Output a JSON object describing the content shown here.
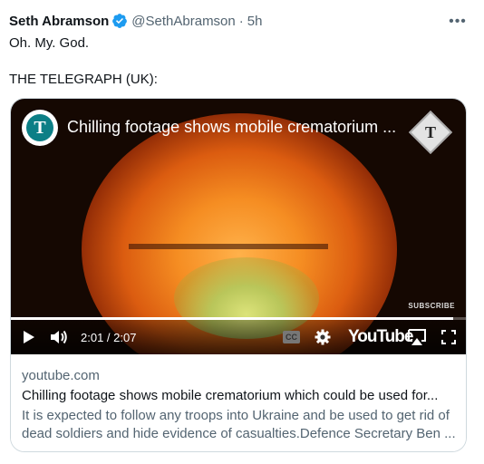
{
  "tweet": {
    "author_name": "Seth Abramson",
    "handle": "@SethAbramson",
    "separator": "·",
    "time": "5h",
    "more_label": "•••",
    "text_line1": "Oh. My. God.",
    "text_line2": "THE TELEGRAPH (UK):"
  },
  "video": {
    "channel_logo_letter": "T",
    "watermark_letter": "T",
    "title": "Chilling footage shows mobile crematorium ...",
    "subscribe_label": "SUBSCRIBE",
    "current_time": "2:01",
    "duration": "2:07",
    "progress_fraction": 0.9685,
    "time_display": "2:01 / 2:07",
    "cc_label": "CC",
    "youtube_label": "YouTube"
  },
  "link_card": {
    "domain": "youtube.com",
    "title": "Chilling footage shows mobile crematorium which could be used for...",
    "desc_line1": "It is expected to follow any troops into Ukraine and be used to get rid of",
    "desc_line2": "dead soldiers and hide evidence of casualties.Defence Secretary Ben ..."
  },
  "colors": {
    "verified": "#1d9bf0",
    "secondary_text": "#536471",
    "telegraph_teal": "#0c7f86",
    "border": "#cfd9de"
  },
  "icons": {
    "verified": "verified-badge-icon",
    "more": "more-icon",
    "play": "play-icon",
    "volume": "volume-icon",
    "captions": "cc-icon",
    "settings": "gear-icon",
    "airplay": "airplay-icon",
    "fullscreen": "fullscreen-icon"
  }
}
